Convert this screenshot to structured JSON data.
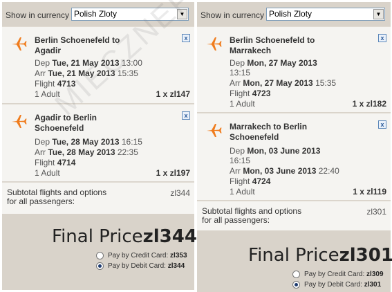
{
  "left": {
    "currency_label": "Show in currency",
    "currency_value": "Polish Zloty",
    "flights": [
      {
        "route_line1": "Berlin Schoenefeld to",
        "route_line2": "Agadir",
        "dep_label": "Dep",
        "dep_value": "Tue, 21 May 2013",
        "dep_time": "13:00",
        "arr_label": "Arr",
        "arr_value": "Tue, 21 May 2013",
        "arr_time": "15:35",
        "flight_label": "Flight",
        "flight_no": "4713",
        "pax": "1 Adult",
        "qty": "1 x zl147",
        "remove": "x"
      },
      {
        "route_line1": "Agadir to Berlin",
        "route_line2": "Schoenefeld",
        "dep_label": "Dep",
        "dep_value": "Tue, 28 May 2013",
        "dep_time": "16:15",
        "arr_label": "Arr",
        "arr_value": "Tue, 28 May 2013",
        "arr_time": "22:35",
        "flight_label": "Flight",
        "flight_no": "4714",
        "pax": "1 Adult",
        "qty": "1 x zl197",
        "remove": "x"
      }
    ],
    "subtotal_line1": "Subtotal flights and options",
    "subtotal_line2": "for all passengers:",
    "subtotal_amount": "zl344",
    "final_label": "Final Price",
    "final_amount": "zl344",
    "pay_credit_label": "Pay by Credit Card:",
    "pay_credit_amount": "zl353",
    "pay_debit_label": "Pay by Debit Card:",
    "pay_debit_amount": "zl344",
    "selected_payment": "debit"
  },
  "right": {
    "currency_label": "Show in currency",
    "currency_value": "Polish Zloty",
    "flights": [
      {
        "route_line1": "Berlin Schoenefeld to",
        "route_line2": "Marrakech",
        "dep_label": "Dep",
        "dep_value": "Mon, 27 May 2013",
        "dep_time": "13:15",
        "arr_label": "Arr",
        "arr_value": "Mon, 27 May 2013",
        "arr_time": "15:35",
        "flight_label": "Flight",
        "flight_no": "4723",
        "pax": "1 Adult",
        "qty": "1 x zl182",
        "remove": "x"
      },
      {
        "route_line1": "Marrakech to Berlin",
        "route_line2": "Schoenefeld",
        "dep_label": "Dep",
        "dep_value": "Mon, 03 June 2013",
        "dep_time": "16:15",
        "arr_label": "Arr",
        "arr_value": "Mon, 03 June 2013",
        "arr_time": "22:40",
        "flight_label": "Flight",
        "flight_no": "4724",
        "pax": "1 Adult",
        "qty": "1 x zl119",
        "remove": "x"
      }
    ],
    "subtotal_line1": "Subtotal flights and options",
    "subtotal_line2": "for all passengers:",
    "subtotal_amount": "zl301",
    "final_label": "Final Price",
    "final_amount": "zl301",
    "pay_credit_label": "Pay by Credit Card:",
    "pay_credit_amount": "zl309",
    "pay_debit_label": "Pay by Debit Card:",
    "pay_debit_amount": "zl301",
    "selected_payment": "debit"
  },
  "watermark": "MIECZNEPODROZE.pl",
  "colors": {
    "panel_bg": "#d9d3ca",
    "card_bg": "#f5f4f1",
    "plane_orange": "#f07c1d"
  },
  "icons": {
    "plane": "airplane-icon",
    "remove": "close-icon",
    "dropdown": "chevron-down-icon"
  }
}
